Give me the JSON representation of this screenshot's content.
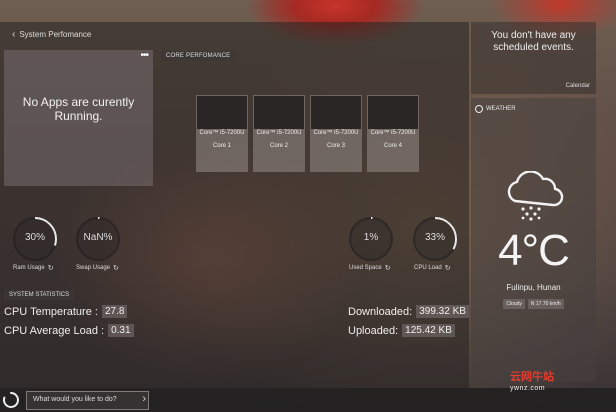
{
  "header": {
    "back_label": "System Perfomance"
  },
  "apps": {
    "menu": "•••",
    "message_line1": "No Apps are curently",
    "message_line2": "Running."
  },
  "core_section": {
    "label": "CORE PERFOMANCE",
    "cores": [
      {
        "name_line1": "Core™ i5-7200U",
        "name_line2": "",
        "number": "Core 1"
      },
      {
        "name_line1": "Core™ i5-7200U",
        "name_line2": "",
        "number": "Core 2"
      },
      {
        "name_line1": "Core™ i5-7200U",
        "name_line2": "",
        "number": "Core 3"
      },
      {
        "name_line1": "Core™ i5-7200U",
        "name_line2": "",
        "number": "Core 4"
      }
    ]
  },
  "gauges": [
    {
      "value": "30%",
      "label": "Ram Usage",
      "fraction": 0.3
    },
    {
      "value": "NaN%",
      "label": "Swap Usage",
      "fraction": 0
    },
    {
      "value": "1%",
      "label": "Used Space",
      "fraction": 0.01
    },
    {
      "value": "33%",
      "label": "CPU Load",
      "fraction": 0.33
    }
  ],
  "refresh_icon": "↻",
  "stats": {
    "label": "SYSTEM STATISTICS",
    "cpu_temp_label": "CPU Temperature :",
    "cpu_temp_value": "27.8",
    "cpu_load_label": "CPU Average Load :",
    "cpu_load_value": "0.31",
    "downloaded_label": "Downloaded:",
    "downloaded_value": "399.32 KB",
    "uploaded_label": "Uploaded:",
    "uploaded_value": "125.42 KB"
  },
  "events": {
    "line1": "You don't have any",
    "line2": "scheduled events.",
    "calendar": "Calendar"
  },
  "weather": {
    "header": "WEATHER",
    "temperature": "4°C",
    "city": "Fulinpu, Hunan",
    "condition": "Cloudy",
    "wind": "N 17.70 km/h"
  },
  "bottom": {
    "placeholder": "What would you like to do?",
    "arrow": "›"
  },
  "watermark": {
    "main": "云网牛站",
    "sub": "ywnz.com"
  }
}
